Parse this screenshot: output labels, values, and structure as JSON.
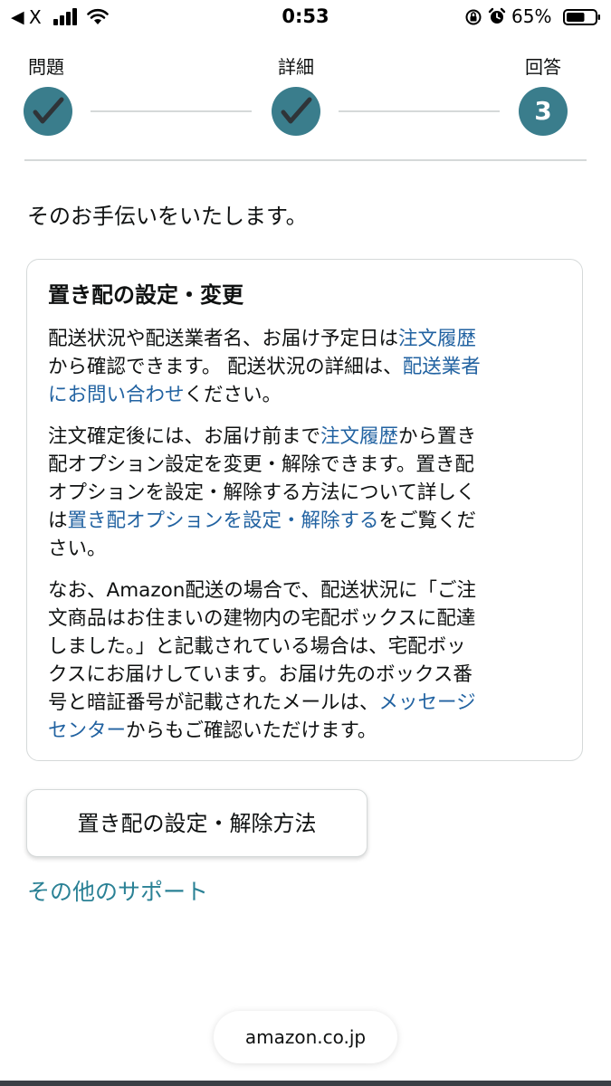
{
  "status_bar": {
    "back_glyph": "◀",
    "carrier": "X",
    "time": "0:53",
    "battery_percent": "65%",
    "battery_level": 0.65,
    "icons": [
      "back-arrow-icon",
      "signal-icon",
      "wifi-icon",
      "orientation-lock-icon",
      "alarm-icon",
      "battery-icon"
    ]
  },
  "stepper": {
    "steps": [
      {
        "label": "問題",
        "state": "done",
        "icon": "checkmark-icon"
      },
      {
        "label": "詳細",
        "state": "done",
        "icon": "checkmark-icon"
      },
      {
        "label": "回答",
        "state": "current",
        "number": "3"
      }
    ],
    "accent_color": "#3a7d8c"
  },
  "intro_text": "そのお手伝いをいたします。",
  "card": {
    "title": "置き配の設定・変更",
    "p1": {
      "l1_text": "配送状況や配送業者名、お届け予定日は",
      "l1_link": "注文履歴",
      "l2_text": "から確認できます。 配送状況の詳細は、",
      "l2_link": "配送業者",
      "l3_link": "にお問い合わせ",
      "l3_text": "ください。"
    },
    "p2": {
      "l1_text": "注文確定後には、お届け前まで",
      "l1_link": "注文履歴",
      "l1_after": "から置き",
      "l2_text": "配オプション設定を変更・解除できます。置き配",
      "l3_text": "オプションを設定・解除する方法について詳しく",
      "l4_before": "は",
      "l4_link": "置き配オプションを設定・解除する",
      "l4_after": "をご覧くだ",
      "l5_text": "さい。"
    },
    "p3": {
      "l1_text": "なお、Amazon配送の場合で、配送状況に「ご注",
      "l2_text": "文商品はお住まいの建物内の宅配ボックスに配達",
      "l3_text": "しました。」と記載されている場合は、宅配ボッ",
      "l4_text": "クスにお届けしています。お届け先のボックス番",
      "l5_text": "号と暗証番号が記載されたメールは、",
      "l5_link": "メッセージ",
      "l6_link": "センター",
      "l6_text": "からもご確認いただけます。"
    }
  },
  "action_button": {
    "label": "置き配の設定・解除方法"
  },
  "support_link": {
    "label": "その他のサポート"
  },
  "url_bar": {
    "domain": "amazon.co.jp"
  },
  "colors": {
    "link": "#2162a1",
    "support_link": "#2a8195",
    "border": "#d5d9d9",
    "text": "#0f1111"
  }
}
